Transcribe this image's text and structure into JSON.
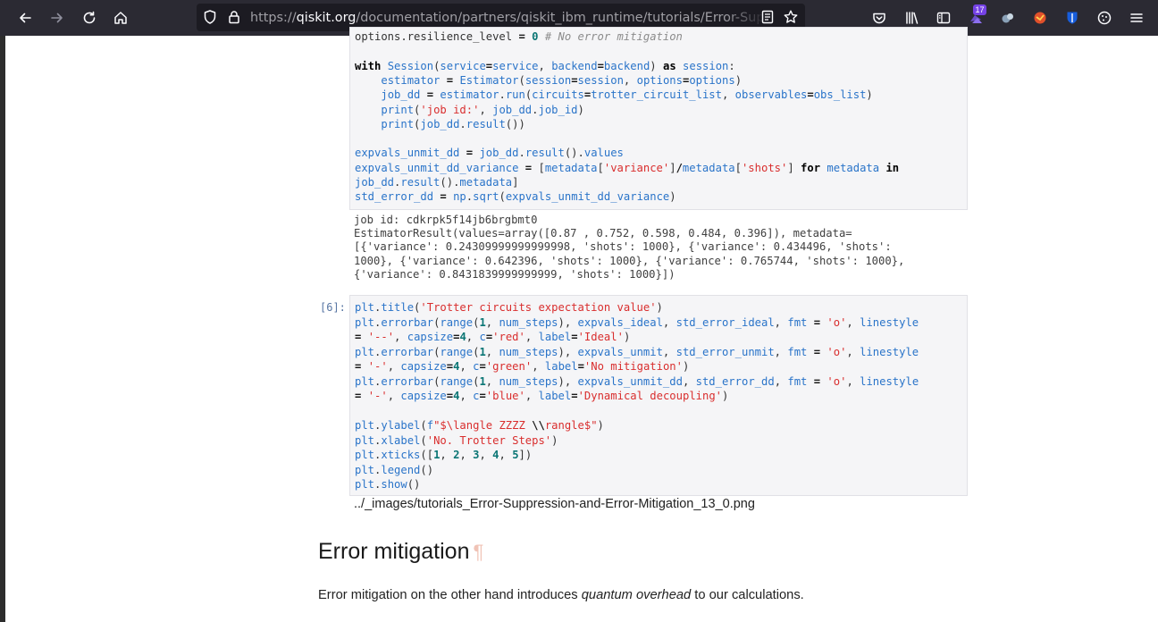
{
  "browser": {
    "url_protocol": "https://",
    "url_host": "qiskit.org",
    "url_path": "/documentation/partners/qiskit_ibm_runtime/tutorials/Error-Suppression-and-Error-Mitigation.html",
    "extension_badge_count": "17"
  },
  "cell5": {
    "lines": [
      [
        [
          "t-pl",
          "options.resilience_level "
        ],
        [
          "t-op",
          "="
        ],
        [
          "t-pl",
          " "
        ],
        [
          "t-num",
          "0"
        ],
        [
          "t-pl",
          " "
        ],
        [
          "t-cm",
          "# No error mitigation"
        ]
      ],
      [],
      [
        [
          "t-kw",
          "with"
        ],
        [
          "t-pl",
          " "
        ],
        [
          "t-fn",
          "Session"
        ],
        [
          "t-pl",
          "("
        ],
        [
          "t-nm",
          "service"
        ],
        [
          "t-op",
          "="
        ],
        [
          "t-nm",
          "service"
        ],
        [
          "t-pl",
          ", "
        ],
        [
          "t-nm",
          "backend"
        ],
        [
          "t-op",
          "="
        ],
        [
          "t-nm",
          "backend"
        ],
        [
          "t-pl",
          ") "
        ],
        [
          "t-kw",
          "as"
        ],
        [
          "t-pl",
          " "
        ],
        [
          "t-nm",
          "session"
        ],
        [
          "t-pl",
          ":"
        ]
      ],
      [
        [
          "t-pl",
          "    "
        ],
        [
          "t-nm",
          "estimator"
        ],
        [
          "t-pl",
          " "
        ],
        [
          "t-op",
          "="
        ],
        [
          "t-pl",
          " "
        ],
        [
          "t-fn",
          "Estimator"
        ],
        [
          "t-pl",
          "("
        ],
        [
          "t-nm",
          "session"
        ],
        [
          "t-op",
          "="
        ],
        [
          "t-nm",
          "session"
        ],
        [
          "t-pl",
          ", "
        ],
        [
          "t-nm",
          "options"
        ],
        [
          "t-op",
          "="
        ],
        [
          "t-nm",
          "options"
        ],
        [
          "t-pl",
          ")"
        ]
      ],
      [
        [
          "t-pl",
          "    "
        ],
        [
          "t-nm",
          "job_dd"
        ],
        [
          "t-pl",
          " "
        ],
        [
          "t-op",
          "="
        ],
        [
          "t-pl",
          " "
        ],
        [
          "t-nm",
          "estimator"
        ],
        [
          "t-pl",
          "."
        ],
        [
          "t-fn",
          "run"
        ],
        [
          "t-pl",
          "("
        ],
        [
          "t-nm",
          "circuits"
        ],
        [
          "t-op",
          "="
        ],
        [
          "t-nm",
          "trotter_circuit_list"
        ],
        [
          "t-pl",
          ", "
        ],
        [
          "t-nm",
          "observables"
        ],
        [
          "t-op",
          "="
        ],
        [
          "t-nm",
          "obs_list"
        ],
        [
          "t-pl",
          ")"
        ]
      ],
      [
        [
          "t-pl",
          "    "
        ],
        [
          "t-fn",
          "print"
        ],
        [
          "t-pl",
          "("
        ],
        [
          "t-str",
          "'job id:'"
        ],
        [
          "t-pl",
          ", "
        ],
        [
          "t-nm",
          "job_dd"
        ],
        [
          "t-pl",
          "."
        ],
        [
          "t-nm",
          "job_id"
        ],
        [
          "t-pl",
          ")"
        ]
      ],
      [
        [
          "t-pl",
          "    "
        ],
        [
          "t-fn",
          "print"
        ],
        [
          "t-pl",
          "("
        ],
        [
          "t-nm",
          "job_dd"
        ],
        [
          "t-pl",
          "."
        ],
        [
          "t-fn",
          "result"
        ],
        [
          "t-pl",
          "())"
        ]
      ],
      [],
      [
        [
          "t-nm",
          "expvals_unmit_dd"
        ],
        [
          "t-pl",
          " "
        ],
        [
          "t-op",
          "="
        ],
        [
          "t-pl",
          " "
        ],
        [
          "t-nm",
          "job_dd"
        ],
        [
          "t-pl",
          "."
        ],
        [
          "t-fn",
          "result"
        ],
        [
          "t-pl",
          "()."
        ],
        [
          "t-nm",
          "values"
        ]
      ],
      [
        [
          "t-nm",
          "expvals_unmit_dd_variance"
        ],
        [
          "t-pl",
          " "
        ],
        [
          "t-op",
          "="
        ],
        [
          "t-pl",
          " ["
        ],
        [
          "t-nm",
          "metadata"
        ],
        [
          "t-pl",
          "["
        ],
        [
          "t-str",
          "'variance'"
        ],
        [
          "t-pl",
          "]"
        ],
        [
          "t-op",
          "/"
        ],
        [
          "t-nm",
          "metadata"
        ],
        [
          "t-pl",
          "["
        ],
        [
          "t-str",
          "'shots'"
        ],
        [
          "t-pl",
          "] "
        ],
        [
          "t-kw",
          "for"
        ],
        [
          "t-pl",
          " "
        ],
        [
          "t-nm",
          "metadata"
        ],
        [
          "t-pl",
          " "
        ],
        [
          "t-kw",
          "in"
        ]
      ],
      [
        [
          "t-nm",
          "job_dd"
        ],
        [
          "t-pl",
          "."
        ],
        [
          "t-fn",
          "result"
        ],
        [
          "t-pl",
          "()."
        ],
        [
          "t-nm",
          "metadata"
        ],
        [
          "t-pl",
          "]"
        ]
      ],
      [
        [
          "t-nm",
          "std_error_dd"
        ],
        [
          "t-pl",
          " "
        ],
        [
          "t-op",
          "="
        ],
        [
          "t-pl",
          " "
        ],
        [
          "t-nm",
          "np"
        ],
        [
          "t-pl",
          "."
        ],
        [
          "t-fn",
          "sqrt"
        ],
        [
          "t-pl",
          "("
        ],
        [
          "t-nm",
          "expvals_unmit_dd_variance"
        ],
        [
          "t-pl",
          ")"
        ]
      ]
    ]
  },
  "output5": {
    "lines": [
      "job id: cdkrpk5f14jb6brgbmt0",
      "EstimatorResult(values=array([0.87 , 0.752, 0.598, 0.484, 0.396]), metadata=",
      "[{'variance': 0.24309999999999998, 'shots': 1000}, {'variance': 0.434496, 'shots':",
      "1000}, {'variance': 0.642396, 'shots': 1000}, {'variance': 0.765744, 'shots': 1000},",
      "{'variance': 0.8431839999999999, 'shots': 1000}])"
    ]
  },
  "cell6": {
    "prompt": "[6]:",
    "lines": [
      [
        [
          "t-nm",
          "plt"
        ],
        [
          "t-pl",
          "."
        ],
        [
          "t-fn",
          "title"
        ],
        [
          "t-pl",
          "("
        ],
        [
          "t-str",
          "'Trotter circuits expectation value'"
        ],
        [
          "t-pl",
          ")"
        ]
      ],
      [
        [
          "t-nm",
          "plt"
        ],
        [
          "t-pl",
          "."
        ],
        [
          "t-fn",
          "errorbar"
        ],
        [
          "t-pl",
          "("
        ],
        [
          "t-fn",
          "range"
        ],
        [
          "t-pl",
          "("
        ],
        [
          "t-num",
          "1"
        ],
        [
          "t-pl",
          ", "
        ],
        [
          "t-nm",
          "num_steps"
        ],
        [
          "t-pl",
          "), "
        ],
        [
          "t-nm",
          "expvals_ideal"
        ],
        [
          "t-pl",
          ", "
        ],
        [
          "t-nm",
          "std_error_ideal"
        ],
        [
          "t-pl",
          ", "
        ],
        [
          "t-nm",
          "fmt"
        ],
        [
          "t-pl",
          " "
        ],
        [
          "t-op",
          "="
        ],
        [
          "t-pl",
          " "
        ],
        [
          "t-str",
          "'o'"
        ],
        [
          "t-pl",
          ", "
        ],
        [
          "t-nm",
          "linestyle"
        ]
      ],
      [
        [
          "t-op",
          "="
        ],
        [
          "t-pl",
          " "
        ],
        [
          "t-str",
          "'--'"
        ],
        [
          "t-pl",
          ", "
        ],
        [
          "t-nm",
          "capsize"
        ],
        [
          "t-op",
          "="
        ],
        [
          "t-num",
          "4"
        ],
        [
          "t-pl",
          ", "
        ],
        [
          "t-nm",
          "c"
        ],
        [
          "t-op",
          "="
        ],
        [
          "t-str",
          "'red'"
        ],
        [
          "t-pl",
          ", "
        ],
        [
          "t-nm",
          "label"
        ],
        [
          "t-op",
          "="
        ],
        [
          "t-str",
          "'Ideal'"
        ],
        [
          "t-pl",
          ")"
        ]
      ],
      [
        [
          "t-nm",
          "plt"
        ],
        [
          "t-pl",
          "."
        ],
        [
          "t-fn",
          "errorbar"
        ],
        [
          "t-pl",
          "("
        ],
        [
          "t-fn",
          "range"
        ],
        [
          "t-pl",
          "("
        ],
        [
          "t-num",
          "1"
        ],
        [
          "t-pl",
          ", "
        ],
        [
          "t-nm",
          "num_steps"
        ],
        [
          "t-pl",
          "), "
        ],
        [
          "t-nm",
          "expvals_unmit"
        ],
        [
          "t-pl",
          ", "
        ],
        [
          "t-nm",
          "std_error_unmit"
        ],
        [
          "t-pl",
          ", "
        ],
        [
          "t-nm",
          "fmt"
        ],
        [
          "t-pl",
          " "
        ],
        [
          "t-op",
          "="
        ],
        [
          "t-pl",
          " "
        ],
        [
          "t-str",
          "'o'"
        ],
        [
          "t-pl",
          ", "
        ],
        [
          "t-nm",
          "linestyle"
        ]
      ],
      [
        [
          "t-op",
          "="
        ],
        [
          "t-pl",
          " "
        ],
        [
          "t-str",
          "'-'"
        ],
        [
          "t-pl",
          ", "
        ],
        [
          "t-nm",
          "capsize"
        ],
        [
          "t-op",
          "="
        ],
        [
          "t-num",
          "4"
        ],
        [
          "t-pl",
          ", "
        ],
        [
          "t-nm",
          "c"
        ],
        [
          "t-op",
          "="
        ],
        [
          "t-str",
          "'green'"
        ],
        [
          "t-pl",
          ", "
        ],
        [
          "t-nm",
          "label"
        ],
        [
          "t-op",
          "="
        ],
        [
          "t-str",
          "'No mitigation'"
        ],
        [
          "t-pl",
          ")"
        ]
      ],
      [
        [
          "t-nm",
          "plt"
        ],
        [
          "t-pl",
          "."
        ],
        [
          "t-fn",
          "errorbar"
        ],
        [
          "t-pl",
          "("
        ],
        [
          "t-fn",
          "range"
        ],
        [
          "t-pl",
          "("
        ],
        [
          "t-num",
          "1"
        ],
        [
          "t-pl",
          ", "
        ],
        [
          "t-nm",
          "num_steps"
        ],
        [
          "t-pl",
          "), "
        ],
        [
          "t-nm",
          "expvals_unmit_dd"
        ],
        [
          "t-pl",
          ", "
        ],
        [
          "t-nm",
          "std_error_dd"
        ],
        [
          "t-pl",
          ", "
        ],
        [
          "t-nm",
          "fmt"
        ],
        [
          "t-pl",
          " "
        ],
        [
          "t-op",
          "="
        ],
        [
          "t-pl",
          " "
        ],
        [
          "t-str",
          "'o'"
        ],
        [
          "t-pl",
          ", "
        ],
        [
          "t-nm",
          "linestyle"
        ]
      ],
      [
        [
          "t-op",
          "="
        ],
        [
          "t-pl",
          " "
        ],
        [
          "t-str",
          "'-'"
        ],
        [
          "t-pl",
          ", "
        ],
        [
          "t-nm",
          "capsize"
        ],
        [
          "t-op",
          "="
        ],
        [
          "t-num",
          "4"
        ],
        [
          "t-pl",
          ", "
        ],
        [
          "t-nm",
          "c"
        ],
        [
          "t-op",
          "="
        ],
        [
          "t-str",
          "'blue'"
        ],
        [
          "t-pl",
          ", "
        ],
        [
          "t-nm",
          "label"
        ],
        [
          "t-op",
          "="
        ],
        [
          "t-str",
          "'Dynamical decoupling'"
        ],
        [
          "t-pl",
          ")"
        ]
      ],
      [],
      [
        [
          "t-nm",
          "plt"
        ],
        [
          "t-pl",
          "."
        ],
        [
          "t-fn",
          "ylabel"
        ],
        [
          "t-pl",
          "("
        ],
        [
          "t-nm",
          "f"
        ],
        [
          "t-str",
          "\"$\\langle ZZZZ "
        ],
        [
          "t-op",
          "\\\\"
        ],
        [
          "t-str",
          "rangle$\""
        ],
        [
          "t-pl",
          ")"
        ]
      ],
      [
        [
          "t-nm",
          "plt"
        ],
        [
          "t-pl",
          "."
        ],
        [
          "t-fn",
          "xlabel"
        ],
        [
          "t-pl",
          "("
        ],
        [
          "t-str",
          "'No. Trotter Steps'"
        ],
        [
          "t-pl",
          ")"
        ]
      ],
      [
        [
          "t-nm",
          "plt"
        ],
        [
          "t-pl",
          "."
        ],
        [
          "t-fn",
          "xticks"
        ],
        [
          "t-pl",
          "(["
        ],
        [
          "t-num",
          "1"
        ],
        [
          "t-pl",
          ", "
        ],
        [
          "t-num",
          "2"
        ],
        [
          "t-pl",
          ", "
        ],
        [
          "t-num",
          "3"
        ],
        [
          "t-pl",
          ", "
        ],
        [
          "t-num",
          "4"
        ],
        [
          "t-pl",
          ", "
        ],
        [
          "t-num",
          "5"
        ],
        [
          "t-pl",
          "])"
        ]
      ],
      [
        [
          "t-nm",
          "plt"
        ],
        [
          "t-pl",
          "."
        ],
        [
          "t-fn",
          "legend"
        ],
        [
          "t-pl",
          "()"
        ]
      ],
      [
        [
          "t-nm",
          "plt"
        ],
        [
          "t-pl",
          "."
        ],
        [
          "t-fn",
          "show"
        ],
        [
          "t-pl",
          "()"
        ]
      ]
    ]
  },
  "image_path": "../_images/tutorials_Error-Suppression-and-Error-Mitigation_13_0.png",
  "section": {
    "heading": "Error mitigation",
    "anchor": "¶",
    "para_before": "Error mitigation on the other hand introduces ",
    "para_em": "quantum overhead",
    "para_after": " to our calculations."
  },
  "icons": [
    "back-arrow-icon",
    "forward-arrow-icon",
    "reload-icon",
    "home-icon",
    "shield-icon",
    "lock-icon",
    "reader-view-icon",
    "bookmark-star-icon",
    "pocket-icon",
    "library-icon",
    "sidebar-icon",
    "extension-icon",
    "extension-icon",
    "extension-icon",
    "bitwarden-icon",
    "cookie-icon",
    "hamburger-menu-icon"
  ]
}
